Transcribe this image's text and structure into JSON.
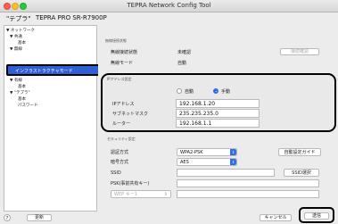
{
  "window": {
    "title": "TEPRA Network Config Tool"
  },
  "device": {
    "name_label": "\"テプラ\"",
    "model": "TEPRA PRO SR-R7900P"
  },
  "sidebar": {
    "items": [
      {
        "label": "▼ ネットワーク"
      },
      {
        "label": "▼ 共通"
      },
      {
        "label": "基本"
      },
      {
        "label": "▼ 無線"
      },
      {
        "label": "インフラストラクチャモード"
      },
      {
        "label": "▼ 有線"
      },
      {
        "label": "基本"
      },
      {
        "label": "▼ \"テプラ\""
      },
      {
        "label": "基本"
      },
      {
        "label": "パスワード"
      }
    ]
  },
  "wireless_status": {
    "heading": "無線接続状態",
    "state_label": "無線接続状態",
    "state_value": "未確認",
    "mode_label": "無線モード",
    "mode_value": "自動",
    "check_button": "接続確認"
  },
  "ip": {
    "heading": "IPアドレス設定",
    "auto_label": "自動",
    "manual_label": "手動",
    "address_label": "IPアドレス",
    "address_value": "192.168.1.20",
    "subnet_label": "サブネットマスク",
    "subnet_value": "235.235.235.0",
    "router_label": "ルーター",
    "router_value": "192.168.1.1"
  },
  "security": {
    "heading": "セキュリティ設定",
    "auth_label": "認証方式",
    "auth_value": "WPA2-PSK",
    "auto_guide_button": "自動設定ガイド",
    "enc_label": "暗号方式",
    "enc_value": "AES",
    "ssid_label": "SSID",
    "ssid_button": "SSID選択",
    "psk_label": "PSK(事前共有キー)",
    "wep_label": "WEP キー1"
  },
  "footer": {
    "help": "?",
    "update_button": "更新",
    "cancel_button": "キャンセル",
    "send_button": "送信"
  }
}
